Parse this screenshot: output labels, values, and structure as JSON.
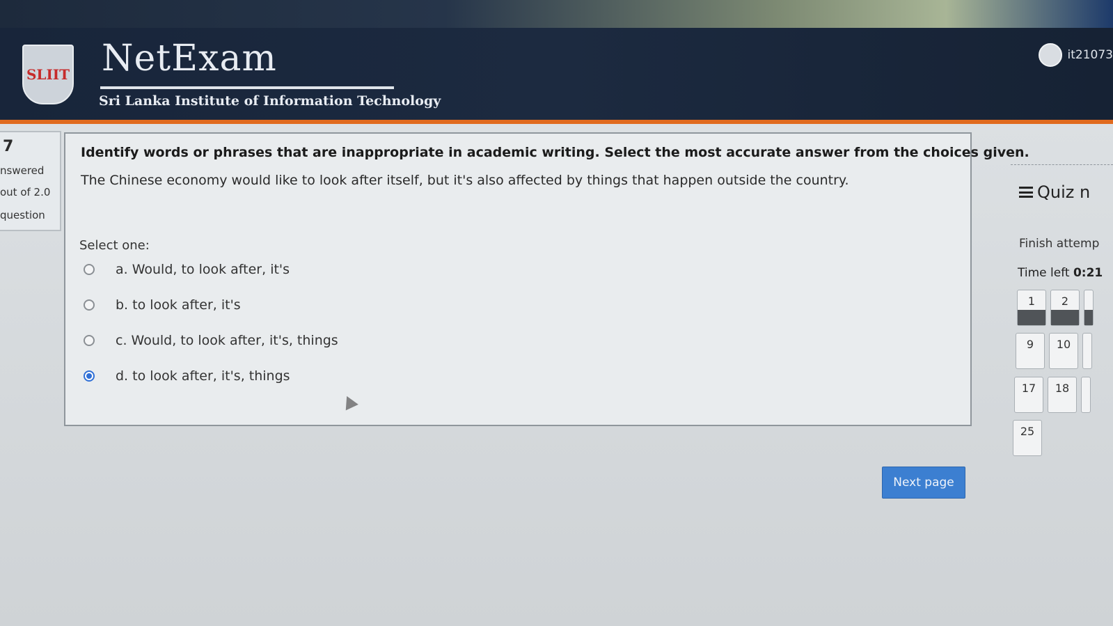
{
  "header": {
    "logo_text": "SLIIT",
    "brand": "NetExam",
    "subtitle": "Sri Lanka Institute of Information Technology",
    "user_id": "it21073"
  },
  "info": {
    "question_number": "7",
    "status": "nswered",
    "mark": "out of 2.0",
    "flag": "question"
  },
  "question": {
    "prompt": "Identify words or phrases that are inappropriate in academic writing. Select the most accurate answer from the choices given.",
    "text": "The Chinese economy would like to look after itself, but it's also affected by things that happen outside the country.",
    "select_label": "Select one:",
    "options": [
      {
        "label": "a. Would, to look after, it's",
        "checked": false
      },
      {
        "label": "b. to look after, it's",
        "checked": false
      },
      {
        "label": "c. Would, to look after, it's, things",
        "checked": false
      },
      {
        "label": "d. to look after, it's, things",
        "checked": true
      }
    ]
  },
  "next_button": "Next page",
  "navigation": {
    "title": "Quiz n",
    "finish": "Finish attemp",
    "time_label": "Time left",
    "time_value": "0:21",
    "buttons": [
      {
        "label": "1",
        "answered": true
      },
      {
        "label": "2",
        "answered": true
      },
      {
        "label": "9",
        "answered": false
      },
      {
        "label": "10",
        "answered": false
      },
      {
        "label": "17",
        "answered": false
      },
      {
        "label": "18",
        "answered": false
      },
      {
        "label": "25",
        "answered": false
      }
    ]
  },
  "colors": {
    "header_bg": "#1c2a40",
    "accent_orange": "#e06a1e",
    "button_blue": "#3c7fd1",
    "radio_selected": "#2f6fd6"
  }
}
